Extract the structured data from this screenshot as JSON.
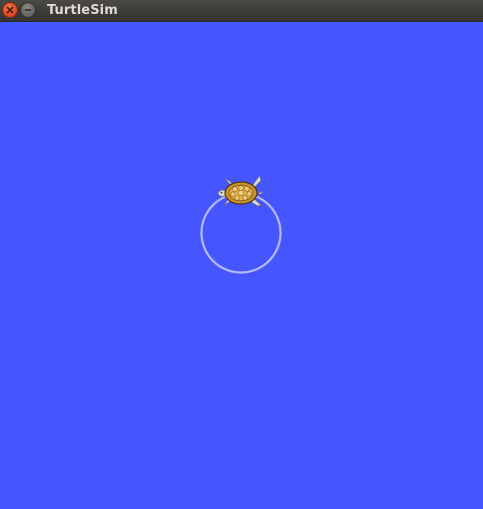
{
  "window": {
    "title": "TurtleSim"
  },
  "colors": {
    "background": "#4556ff",
    "trail": "#b3b8ff",
    "titlebar": "#3d3c38",
    "title_text": "#dfdbd2",
    "close_button": "#e5532c",
    "minimize_button": "#6f6d67"
  },
  "icons": {
    "close": "close-icon",
    "minimize": "minimize-icon",
    "turtle": "turtle-icon"
  }
}
